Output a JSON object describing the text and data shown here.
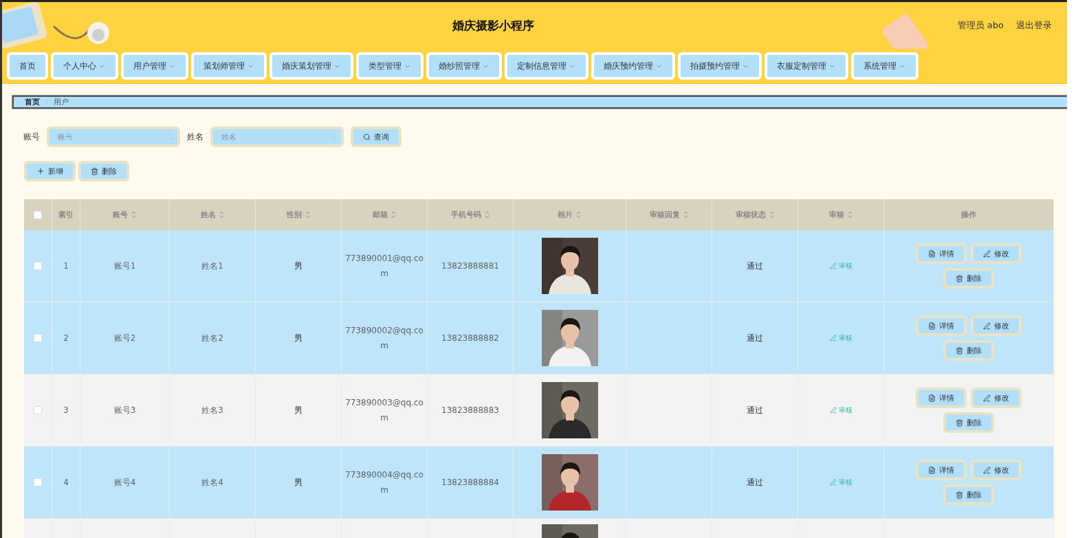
{
  "header": {
    "title": "婚庆摄影小程序",
    "user": "管理员 abo",
    "logout": "退出登录"
  },
  "nav": [
    {
      "label": "首页",
      "dropdown": false
    },
    {
      "label": "个人中心",
      "dropdown": true
    },
    {
      "label": "用户管理",
      "dropdown": true
    },
    {
      "label": "策划师管理",
      "dropdown": true
    },
    {
      "label": "婚庆策划管理",
      "dropdown": true
    },
    {
      "label": "类型管理",
      "dropdown": true
    },
    {
      "label": "婚纱照管理",
      "dropdown": true
    },
    {
      "label": "定制信息管理",
      "dropdown": true
    },
    {
      "label": "婚庆预约管理",
      "dropdown": true
    },
    {
      "label": "拍摄预约管理",
      "dropdown": true
    },
    {
      "label": "衣服定制管理",
      "dropdown": true
    },
    {
      "label": "系统管理",
      "dropdown": true
    }
  ],
  "breadcrumb": {
    "separator": "/",
    "items": [
      "首页",
      "用户"
    ]
  },
  "search": {
    "fields": [
      {
        "label": "账号",
        "placeholder": "账号"
      },
      {
        "label": "姓名",
        "placeholder": "姓名"
      }
    ],
    "button": "查询"
  },
  "actions": [
    {
      "kind": "add",
      "label": "新增"
    },
    {
      "kind": "delete",
      "label": "删除"
    }
  ],
  "table": {
    "columns": [
      {
        "label": "索引",
        "sortable": false
      },
      {
        "label": "账号",
        "sortable": true
      },
      {
        "label": "姓名",
        "sortable": true
      },
      {
        "label": "性别",
        "sortable": true
      },
      {
        "label": "邮箱",
        "sortable": true
      },
      {
        "label": "手机号码",
        "sortable": true
      },
      {
        "label": "相片",
        "sortable": true
      },
      {
        "label": "审核回复",
        "sortable": true
      },
      {
        "label": "审核状态",
        "sortable": true
      },
      {
        "label": "审核",
        "sortable": true
      },
      {
        "label": "操作",
        "sortable": false
      }
    ],
    "select_all": {
      "checked": false
    },
    "rows": [
      {
        "highlighted": true,
        "checked": false,
        "index": "1",
        "account": "账号1",
        "name": "姓名1",
        "gender": "男",
        "email": "773890001@qq.com",
        "phone": "13823888881",
        "photo": {
          "kind": "picture"
        },
        "review_status": "通过",
        "review": "审核",
        "buttons": [
          "详情",
          "修改",
          "删除"
        ]
      },
      {
        "highlighted": true,
        "checked": false,
        "index": "2",
        "account": "账号2",
        "name": "姓名2",
        "gender": "男",
        "email": "773890002@qq.com",
        "phone": "13823888882",
        "photo": {
          "kind": "picture"
        },
        "review_status": "通过",
        "review": "审核",
        "buttons": [
          "详情",
          "修改",
          "删除"
        ]
      },
      {
        "highlighted": false,
        "checked": false,
        "index": "3",
        "account": "账号3",
        "name": "姓名3",
        "gender": "男",
        "email": "773890003@qq.com",
        "phone": "13823888883",
        "photo": {
          "kind": "picture"
        },
        "review_status": "通过",
        "review": "审核",
        "buttons": [
          "详情",
          "修改",
          "删除"
        ]
      },
      {
        "highlighted": true,
        "checked": false,
        "index": "4",
        "account": "账号4",
        "name": "姓名4",
        "gender": "男",
        "email": "773890004@qq.com",
        "phone": "13823888884",
        "photo": {
          "kind": "picture"
        },
        "review_status": "通过",
        "review": "审核",
        "buttons": [
          "详情",
          "修改",
          "删除"
        ]
      }
    ],
    "cut_off_row": {
      "highlighted": false,
      "photo": {
        "kind": "picture"
      }
    }
  }
}
